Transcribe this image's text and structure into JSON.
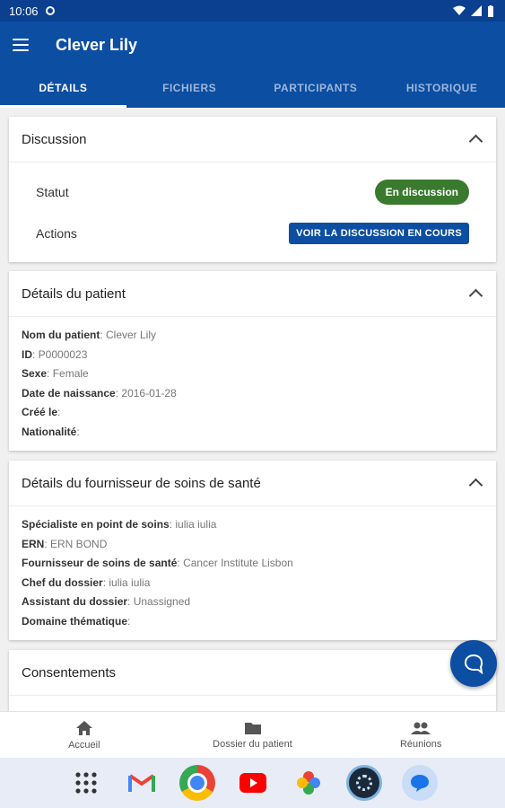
{
  "status_bar": {
    "time": "10:06"
  },
  "app_bar": {
    "title": "Clever Lily"
  },
  "tabs": [
    {
      "label": "DÉTAILS",
      "active": true
    },
    {
      "label": "FICHIERS",
      "active": false
    },
    {
      "label": "PARTICIPANTS",
      "active": false
    },
    {
      "label": "HISTORIQUE",
      "active": false
    }
  ],
  "discussion": {
    "title": "Discussion",
    "status_label": "Statut",
    "status_value": "En discussion",
    "actions_label": "Actions",
    "action_button": "VOIR LA DISCUSSION EN COURS"
  },
  "patient": {
    "title": "Détails du patient",
    "fields": [
      {
        "label": "Nom du patient",
        "value": "Clever Lily"
      },
      {
        "label": "ID",
        "value": "P0000023"
      },
      {
        "label": "Sexe",
        "value": "Female"
      },
      {
        "label": "Date de naissance",
        "value": "2016-01-28"
      },
      {
        "label": "Créé le",
        "value": ""
      },
      {
        "label": "Nationalité",
        "value": ""
      }
    ]
  },
  "provider": {
    "title": "Détails du fournisseur de soins de santé",
    "fields": [
      {
        "label": "Spécialiste en point de soins",
        "value": "iulia iulia"
      },
      {
        "label": "ERN",
        "value": "ERN BOND"
      },
      {
        "label": "Fournisseur de soins de santé",
        "value": "Cancer Institute Lisbon"
      },
      {
        "label": "Chef du dossier",
        "value": "iulia iulia"
      },
      {
        "label": "Assistant du dossier",
        "value": "Unassigned"
      },
      {
        "label": "Domaine thématique",
        "value": ""
      }
    ]
  },
  "consent": {
    "title": "Consentements"
  },
  "bottom_nav": [
    {
      "label": "Accueil",
      "icon": "home-icon"
    },
    {
      "label": "Dossier du patient",
      "icon": "folder-icon"
    },
    {
      "label": "Réunions",
      "icon": "people-icon"
    }
  ],
  "dock_apps": [
    "app-grid",
    "gmail",
    "chrome",
    "youtube",
    "photos",
    "camera-app",
    "messages"
  ],
  "colors": {
    "primary": "#0b4ea2",
    "status_green": "#3a7a2e",
    "dock": "#e8ecf7"
  }
}
